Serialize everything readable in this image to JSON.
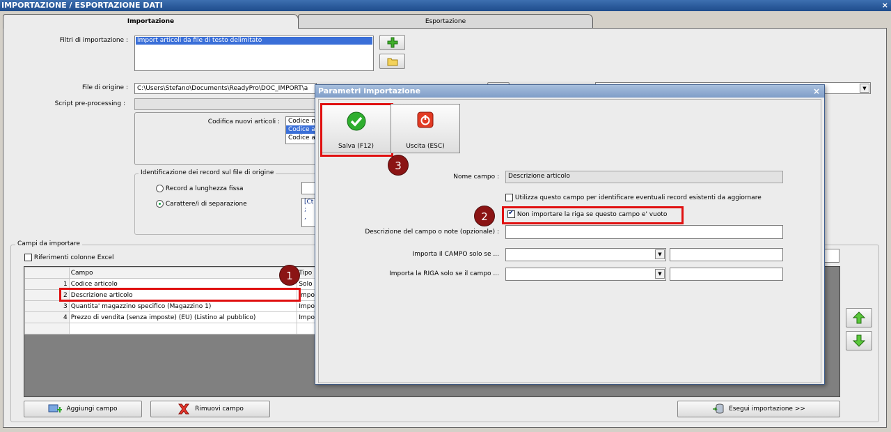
{
  "window": {
    "title": "IMPORTAZIONE / ESPORTAZIONE DATI",
    "close": "×"
  },
  "tabs": [
    {
      "label": "Importazione"
    },
    {
      "label": "Esportazione"
    }
  ],
  "filters": {
    "label": "Filtri di importazione :",
    "items": [
      "Import articoli da file di testo delimitato"
    ]
  },
  "source_file": {
    "label": "File di origine :",
    "value": "C:\\Users\\Stefano\\Documents\\ReadyPro\\DOC_IMPORT\\a"
  },
  "script_pre": {
    "label": "Script pre-processing :",
    "value": ""
  },
  "codifica": {
    "label": "Codifica nuovi articoli :",
    "options": [
      "Codice n",
      "Codice a",
      "Codice a"
    ]
  },
  "identification": {
    "title": "Identificazione dei record sul file di origine",
    "options": [
      "Record a lunghezza fissa",
      "Carattere/i di separazione"
    ],
    "separators": [
      "[Ct",
      ";",
      ","
    ]
  },
  "fields_group": {
    "title": "Campi da importare",
    "excel_refs_label": "Riferimenti colonne Excel",
    "columns": [
      "Campo",
      "Tipo"
    ],
    "rows": [
      {
        "n": "1",
        "campo": "Codice articolo",
        "tipo": "Solo"
      },
      {
        "n": "2",
        "campo": "Descrizione articolo",
        "tipo": "Impo"
      },
      {
        "n": "3",
        "campo": "Quantita' magazzino specifico (Magazzino 1)",
        "tipo": "Impo"
      },
      {
        "n": "4",
        "campo": "Prezzo di vendita (senza imposte) (EU) (Listino al pubblico)",
        "tipo": "Impo"
      }
    ]
  },
  "bottom_buttons": {
    "add": "Aggiungi campo",
    "remove": "Rimuovi campo",
    "run": "Esegui importazione >>"
  },
  "dialog": {
    "title": "Parametri importazione",
    "close": "×",
    "save": "Salva (F12)",
    "exit": "Uscita (ESC)",
    "field_name_label": "Nome campo :",
    "field_name_value": "Descrizione articolo",
    "check_identify": "Utilizza questo campo per identificare eventuali record esistenti da aggiornare",
    "check_skip_empty": "Non importare la riga se questo campo e' vuoto",
    "notes_label": "Descrizione del campo o note (opzionale) :",
    "import_field_if": "Importa il CAMPO solo se ...",
    "import_row_if": "Importa la RIGA solo se il campo ..."
  },
  "annotations": [
    "1",
    "2",
    "3"
  ],
  "colors": {
    "highlight_red": "#e01010",
    "badge": "#8b1414",
    "selection_blue": "#3a6fd8"
  }
}
